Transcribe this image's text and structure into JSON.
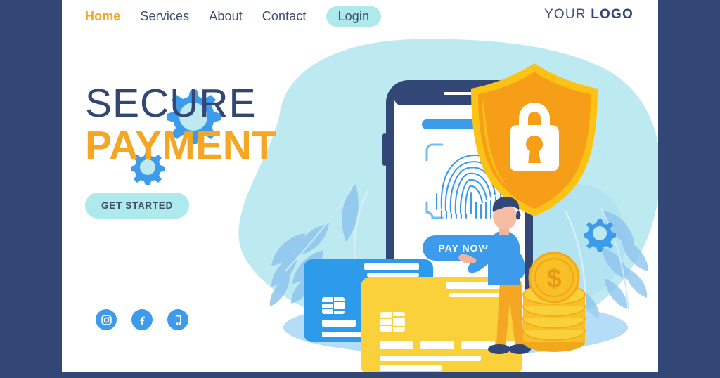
{
  "nav": {
    "items": [
      {
        "label": "Home",
        "state": "active"
      },
      {
        "label": "Services",
        "state": "default"
      },
      {
        "label": "About",
        "state": "default"
      },
      {
        "label": "Contact",
        "state": "default"
      },
      {
        "label": "Login",
        "state": "pill"
      }
    ],
    "logo_prefix": "YOUR ",
    "logo_bold": "LOGO"
  },
  "hero": {
    "headline_line1": "SECURE",
    "headline_line2": "PAYMENT",
    "cta_label": "GET STARTED"
  },
  "socials": [
    {
      "name": "instagram-icon"
    },
    {
      "name": "facebook-icon"
    },
    {
      "name": "mobile-icon"
    }
  ],
  "illustration": {
    "phone_button_label": "PAY NOW",
    "coin_symbol": "$",
    "elements": [
      "blob-background",
      "gear-large-icon",
      "gear-small-icon",
      "gear-right-icon",
      "smartphone",
      "fingerprint-scanner-icon",
      "shield-lock-icon",
      "blue-credit-card",
      "yellow-credit-card",
      "person-illustration",
      "coin-stack",
      "leaf-decoration"
    ]
  },
  "colors": {
    "navy": "#334776",
    "orange": "#F5A623",
    "cyan_pill": "#AEE9EC",
    "blue": "#3C9CEB",
    "blob_cyan": "#BDE9F0",
    "yellow": "#FBD13B",
    "shield_orange": "#F79E19",
    "shield_border": "#FCC316",
    "white": "#FFFFFF"
  }
}
